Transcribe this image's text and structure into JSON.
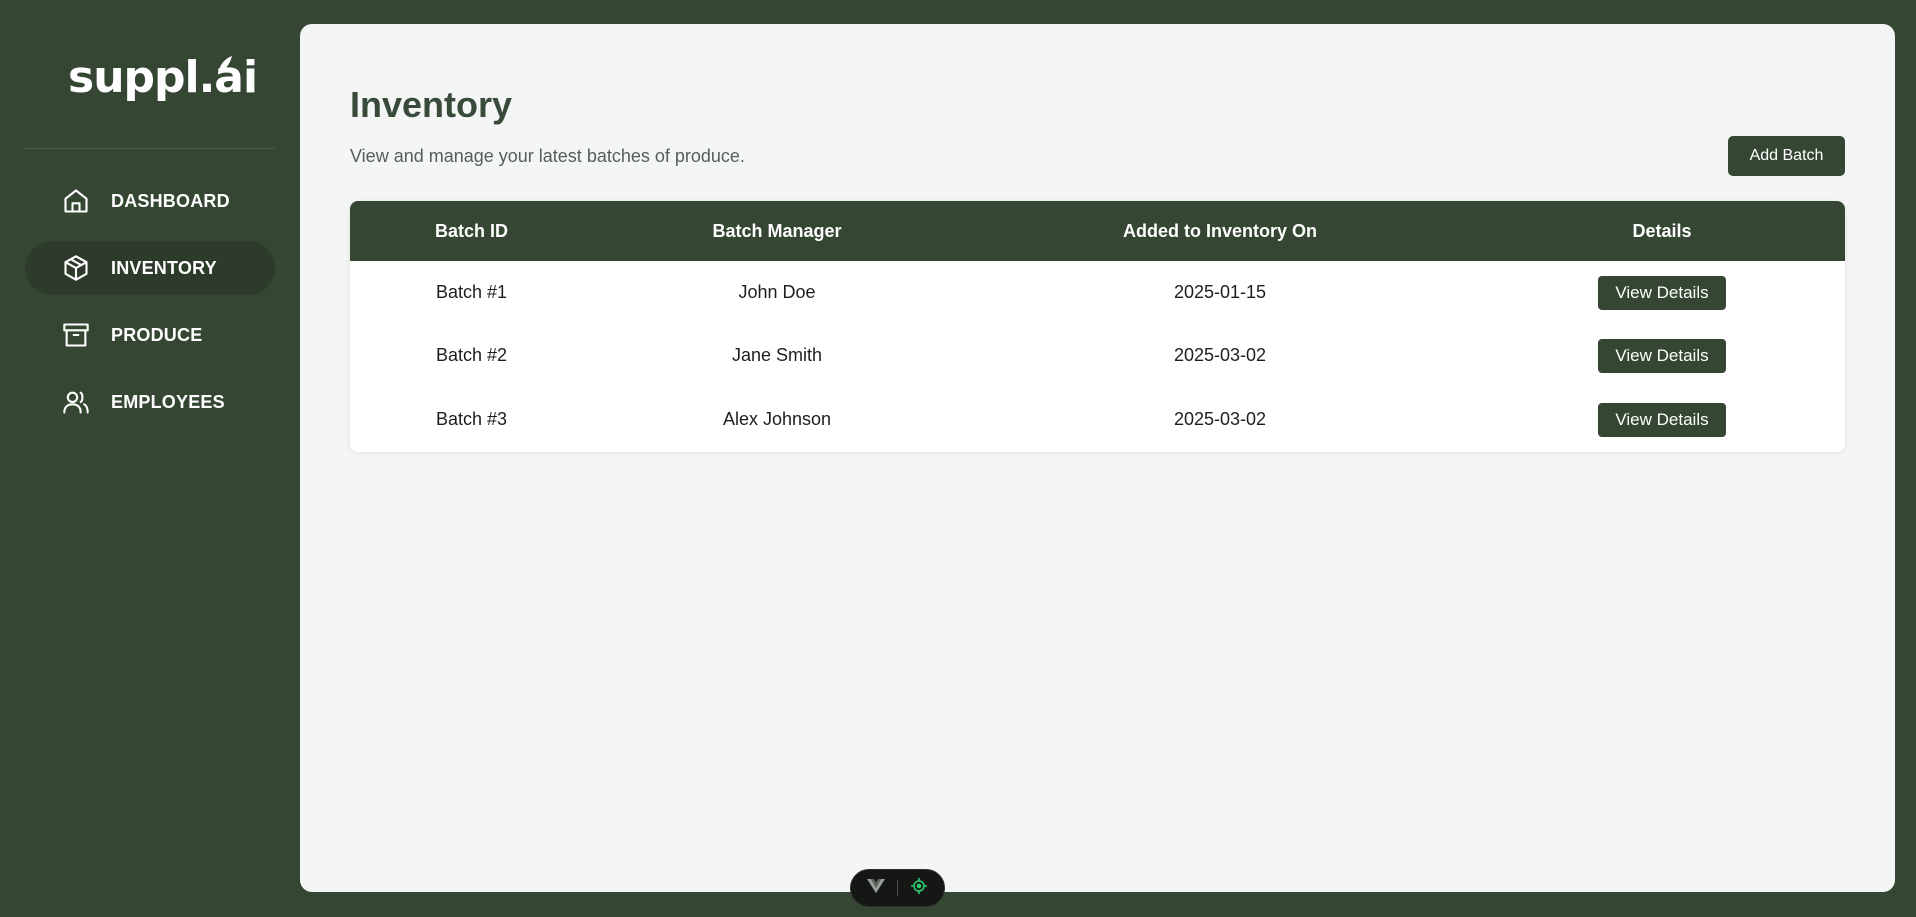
{
  "app": {
    "logo_text": "suppl.ai"
  },
  "sidebar": {
    "items": [
      {
        "label": "DASHBOARD",
        "icon": "home-icon"
      },
      {
        "label": "INVENTORY",
        "icon": "box-icon",
        "active": true
      },
      {
        "label": "PRODUCE",
        "icon": "archive-icon"
      },
      {
        "label": "EMPLOYEES",
        "icon": "users-icon"
      }
    ]
  },
  "main": {
    "title": "Inventory",
    "subtitle": "View and manage your latest batches of produce.",
    "add_button": "Add Batch",
    "table": {
      "columns": [
        "Batch ID",
        "Batch Manager",
        "Added to Inventory On",
        "Details"
      ],
      "rows": [
        {
          "batch_id": "Batch #1",
          "manager": "John Doe",
          "added_on": "2025-01-15",
          "action": "View Details"
        },
        {
          "batch_id": "Batch #2",
          "manager": "Jane Smith",
          "added_on": "2025-03-02",
          "action": "View Details"
        },
        {
          "batch_id": "Batch #3",
          "manager": "Alex Johnson",
          "added_on": "2025-03-02",
          "action": "View Details"
        }
      ]
    }
  },
  "colors": {
    "brand": "#354733",
    "active_nav": "#2c3b2a",
    "content_bg": "#f4f6f5",
    "toolbar_accent": "#2ecc71"
  },
  "toolbar": {
    "icons": [
      "vue-logo-icon",
      "target-icon"
    ]
  }
}
